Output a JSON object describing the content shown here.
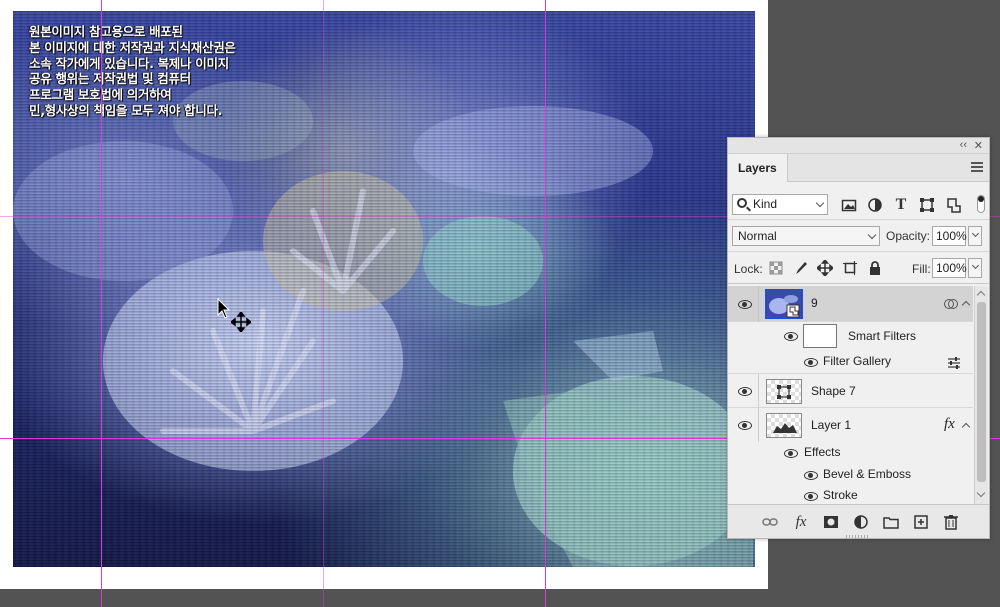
{
  "canvas": {
    "copyright_lines": "원본이미지 참고용으로 배포된\n본 이미지에 대한 저작권과 지식재산권은\n소속 작가에게 있습니다. 복제나 이미지\n공유 행위는 저작권법 및 컴퓨터\n프로그램 보호법에 의거하여\n민,형사상의 책임을 모두 져야 합니다."
  },
  "layers_panel": {
    "collapse_label": "‹‹",
    "close_label": "✕",
    "tab_label": "Layers",
    "filter": {
      "kind_label": "Kind",
      "filter_icons": [
        "image-filter-icon",
        "adjustment-filter-icon",
        "type-filter-icon",
        "shape-filter-icon",
        "smart-object-filter-icon"
      ],
      "type_glyph": "T"
    },
    "blend_mode": "Normal",
    "opacity_label": "Opacity:",
    "opacity_value": "100%",
    "lock_label": "Lock:",
    "fill_label": "Fill:",
    "fill_value": "100%",
    "layers": [
      {
        "name": "9",
        "visible": true,
        "selected": true,
        "type": "smart-object"
      },
      {
        "name": "Smart Filters",
        "visible": true,
        "sub": true
      },
      {
        "name": "Filter Gallery",
        "visible": true,
        "sub": true
      },
      {
        "name": "Shape 7",
        "visible": true
      },
      {
        "name": "Layer 1",
        "visible": true,
        "fx": "fx"
      },
      {
        "name": "Effects",
        "visible": true,
        "sub": true
      },
      {
        "name": "Bevel & Emboss",
        "visible": true,
        "sub": true
      },
      {
        "name": "Stroke",
        "visible": true,
        "sub": true
      }
    ],
    "footer_fx": "fx",
    "colors": {
      "selected_row": "#d3d3d3",
      "panel_bg": "#f0f0f0",
      "guide": "#d63dd6"
    }
  }
}
